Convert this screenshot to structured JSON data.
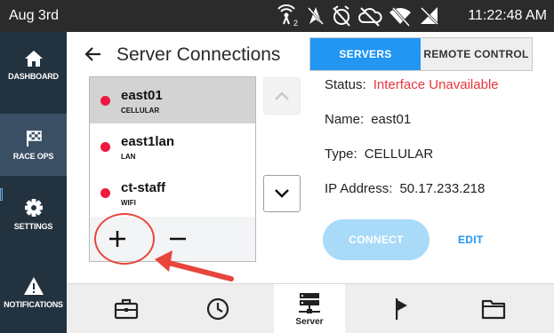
{
  "status_bar": {
    "date": "Aug 3rd",
    "time": "11:22:48 AM",
    "icons": [
      "network-2-icon",
      "location-off-icon",
      "alarm-off-icon",
      "cloud-off-icon",
      "wifi-off-icon",
      "signal-off-icon"
    ]
  },
  "sidebar": {
    "items": [
      {
        "label": "DASHBOARD",
        "icon": "home-icon"
      },
      {
        "label": "RACE OPS",
        "icon": "checkered-flag-icon"
      },
      {
        "label": "SETTINGS",
        "icon": "gear-icon"
      },
      {
        "label": "NOTIFICATIONS",
        "icon": "warning-icon"
      }
    ]
  },
  "header": {
    "title": "Server Connections"
  },
  "tabs": [
    {
      "label": "SERVERS",
      "active": true
    },
    {
      "label": "REMOTE CONTROL",
      "active": false
    }
  ],
  "servers": [
    {
      "name": "east01",
      "type": "CELLULAR",
      "status_color": "#f0183e",
      "selected": true
    },
    {
      "name": "east1lan",
      "type": "LAN",
      "status_color": "#f0183e",
      "selected": false
    },
    {
      "name": "ct-staff",
      "type": "WIFI",
      "status_color": "#f0183e",
      "selected": false
    }
  ],
  "list_controls": {
    "add": "+",
    "remove": "−"
  },
  "details": {
    "status_label": "Status:",
    "status_value": "Interface Unavailable",
    "name_label": "Name:",
    "name_value": "east01",
    "type_label": "Type:",
    "type_value": "CELLULAR",
    "ip_label": "IP Address:",
    "ip_value": "50.17.233.218"
  },
  "actions": {
    "connect": "CONNECT",
    "edit": "EDIT"
  },
  "bottom_nav": {
    "items": [
      {
        "icon": "briefcase-icon",
        "label": ""
      },
      {
        "icon": "clock-icon",
        "label": ""
      },
      {
        "icon": "server-icon",
        "label": "Server",
        "active": true
      },
      {
        "icon": "flag-icon",
        "label": ""
      },
      {
        "icon": "folder-icon",
        "label": ""
      }
    ]
  },
  "colors": {
    "accent": "#2196f3",
    "error": "#e8363f",
    "sidebar_bg": "#22323f",
    "annotation": "#e8453c"
  }
}
